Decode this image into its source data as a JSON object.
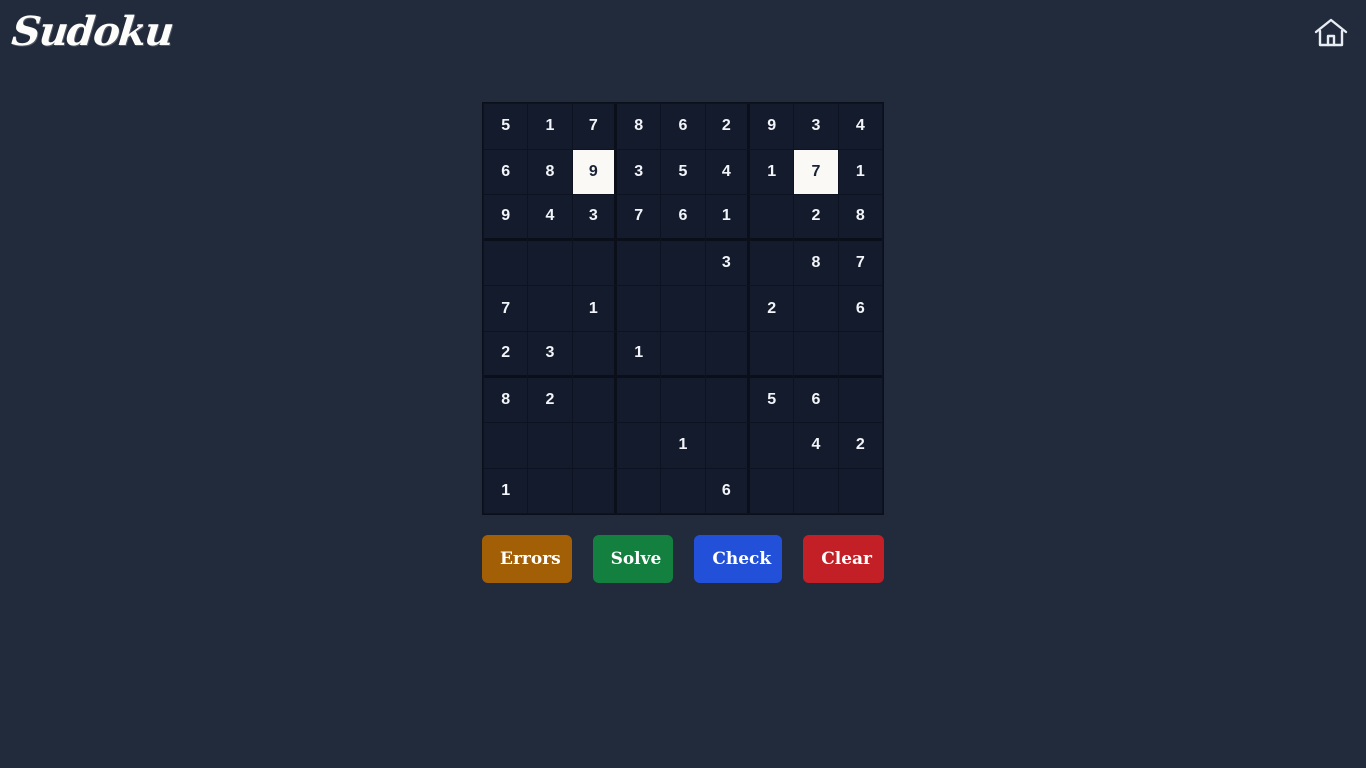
{
  "page": {
    "background_color": "#222b3c"
  },
  "header": {
    "logo_text": "Sudoku",
    "home_icon": "home-icon"
  },
  "board": {
    "rows": 9,
    "columns": 9,
    "cell_empty_background": "#141b2c",
    "cell_user_background": "#faf9f6",
    "grid_line_color": "#0a0f19",
    "cells": [
      [
        "5",
        "1",
        "7",
        "8",
        "6",
        "2",
        "9",
        "3",
        "4"
      ],
      [
        "6",
        "8",
        "9",
        "3",
        "5",
        "4",
        "1",
        "7",
        "1"
      ],
      [
        "9",
        "4",
        "3",
        "7",
        "6",
        "1",
        "",
        "2",
        "8"
      ],
      [
        "",
        "",
        "",
        "",
        "",
        "3",
        "",
        "8",
        "7"
      ],
      [
        "7",
        "",
        "1",
        "",
        "",
        "",
        "2",
        "",
        "6"
      ],
      [
        "2",
        "3",
        "",
        "1",
        "",
        "",
        "",
        "",
        ""
      ],
      [
        "8",
        "2",
        "",
        "",
        "",
        "",
        "5",
        "6",
        ""
      ],
      [
        "",
        "",
        "",
        "",
        "1",
        "",
        "",
        "4",
        "2"
      ],
      [
        "1",
        "",
        "",
        "",
        "",
        "6",
        "",
        "",
        ""
      ]
    ],
    "user_entered": [
      [
        false,
        false,
        false,
        false,
        false,
        false,
        false,
        false,
        false
      ],
      [
        false,
        false,
        true,
        false,
        false,
        false,
        false,
        true,
        false
      ],
      [
        false,
        false,
        false,
        false,
        false,
        false,
        false,
        false,
        false
      ],
      [
        false,
        false,
        false,
        false,
        false,
        false,
        false,
        false,
        false
      ],
      [
        false,
        false,
        false,
        false,
        false,
        false,
        false,
        false,
        false
      ],
      [
        false,
        false,
        false,
        false,
        false,
        false,
        false,
        false,
        false
      ],
      [
        false,
        false,
        false,
        false,
        false,
        false,
        false,
        false,
        false
      ],
      [
        false,
        false,
        false,
        false,
        false,
        false,
        false,
        false,
        false
      ],
      [
        false,
        false,
        false,
        false,
        false,
        false,
        false,
        false,
        false
      ]
    ]
  },
  "controls": {
    "buttons": [
      {
        "id": "errors",
        "label": "Errors",
        "color": "#a35f06"
      },
      {
        "id": "solve",
        "label": "Solve",
        "color": "#14803f"
      },
      {
        "id": "check",
        "label": "Check",
        "color": "#2350d8"
      },
      {
        "id": "clear",
        "label": "Clear",
        "color": "#c22026"
      }
    ]
  }
}
